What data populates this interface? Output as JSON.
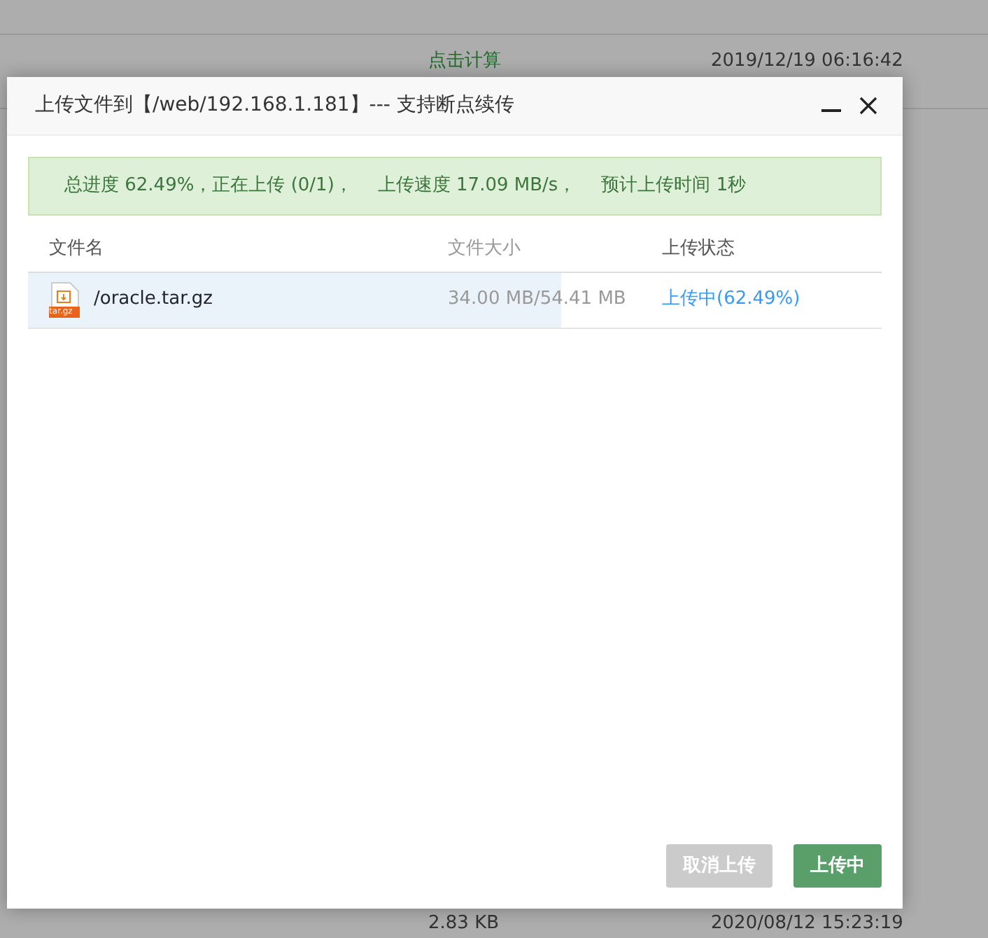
{
  "background_table": {
    "rows": [
      {
        "cells": [
          {
            "kind": "link",
            "text": "点击计算"
          },
          {
            "kind": "text",
            "text": "2019/12/19 06:16:42"
          }
        ]
      },
      {
        "cells": [
          {
            "kind": "text",
            "text": "2.83 KB"
          },
          {
            "kind": "text",
            "text": "2020/08/12 15:23:19"
          }
        ]
      }
    ]
  },
  "dialog": {
    "title": "上传文件到【/web/192.168.1.181】--- 支持断点续传",
    "summary": {
      "progress": "总进度 62.49%，正在上传 (0/1)，",
      "speed": "上传速度 17.09 MB/s，",
      "eta": "预计上传时间 1秒"
    },
    "columns": [
      "文件名",
      "文件大小",
      "上传状态"
    ],
    "files": [
      {
        "name": "/oracle.tar.gz",
        "icon_label": "tar.gz",
        "size": "34.00 MB/54.41 MB",
        "status": "上传中(62.49%)",
        "level": 0.6249
      }
    ],
    "buttons": [
      {
        "label": "取消上传",
        "disabled": true
      },
      {
        "label": "上传中",
        "disabled": false
      }
    ]
  }
}
